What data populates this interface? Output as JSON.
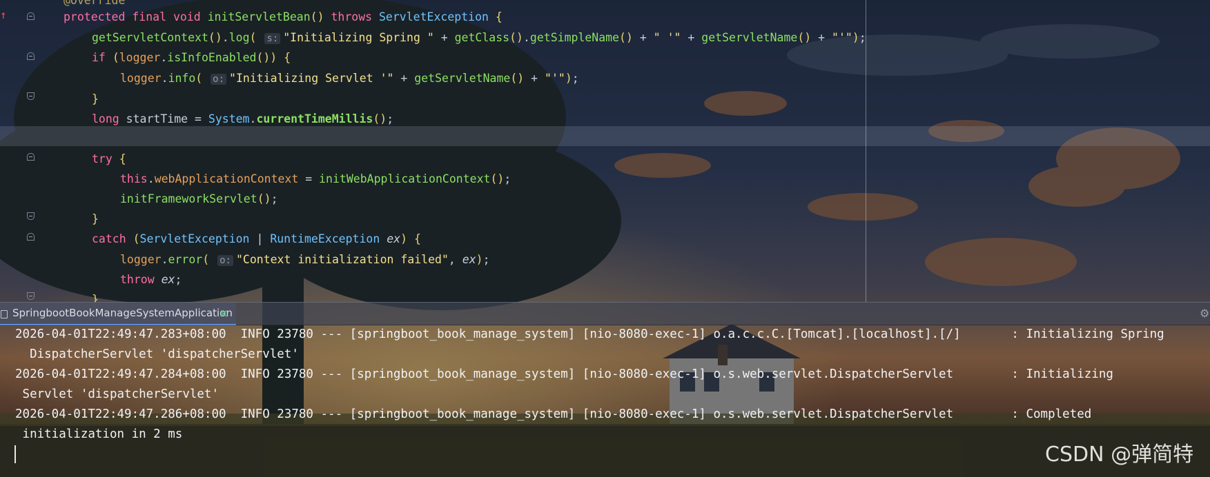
{
  "editor": {
    "lines": [
      {
        "id": "l0",
        "parts": [
          [
            "annot",
            "@Override"
          ]
        ]
      },
      {
        "id": "l1",
        "parts": [
          [
            "kw",
            "protected final void "
          ],
          [
            "fn",
            "initServletBean"
          ],
          [
            "br",
            "() "
          ],
          [
            "kw",
            "throws "
          ],
          [
            "cls",
            "ServletException "
          ],
          [
            "br",
            "{"
          ]
        ]
      },
      {
        "id": "l2",
        "parts": [
          [
            "fn",
            "getServletContext"
          ],
          [
            "br",
            "()"
          ],
          [
            "var",
            "."
          ],
          [
            "fn",
            "log"
          ],
          [
            "br",
            "( "
          ],
          [
            "hint",
            "s:"
          ],
          [
            "str",
            "\"Initializing Spring \" "
          ],
          [
            "var",
            "+ "
          ],
          [
            "fn",
            "getClass"
          ],
          [
            "br",
            "()"
          ],
          [
            "var",
            "."
          ],
          [
            "fn",
            "getSimpleName"
          ],
          [
            "br",
            "() "
          ],
          [
            "var",
            "+ "
          ],
          [
            "str",
            "\" '\" "
          ],
          [
            "var",
            "+ "
          ],
          [
            "fn",
            "getServletName"
          ],
          [
            "br",
            "() "
          ],
          [
            "var",
            "+ "
          ],
          [
            "str",
            "\"'\""
          ],
          [
            "br",
            ")"
          ],
          [
            "var",
            ";"
          ]
        ]
      },
      {
        "id": "l3",
        "parts": [
          [
            "kw",
            "if "
          ],
          [
            "br",
            "("
          ],
          [
            "fld",
            "logger"
          ],
          [
            "var",
            "."
          ],
          [
            "fn",
            "isInfoEnabled"
          ],
          [
            "br",
            "()) {"
          ]
        ]
      },
      {
        "id": "l4",
        "parts": [
          [
            "fld",
            "logger"
          ],
          [
            "var",
            "."
          ],
          [
            "fn",
            "info"
          ],
          [
            "br",
            "( "
          ],
          [
            "hint",
            "o:"
          ],
          [
            "str",
            "\"Initializing Servlet '\" "
          ],
          [
            "var",
            "+ "
          ],
          [
            "fn",
            "getServletName"
          ],
          [
            "br",
            "() "
          ],
          [
            "var",
            "+ "
          ],
          [
            "str",
            "\"'\""
          ],
          [
            "br",
            ")"
          ],
          [
            "var",
            ";"
          ]
        ]
      },
      {
        "id": "l5",
        "parts": [
          [
            "br",
            "}"
          ]
        ]
      },
      {
        "id": "l6",
        "parts": [
          [
            "kw",
            "long "
          ],
          [
            "var",
            "startTime = "
          ],
          [
            "cls",
            "System"
          ],
          [
            "var",
            "."
          ],
          [
            "fnb",
            "currentTimeMillis"
          ],
          [
            "br",
            "()"
          ],
          [
            "var",
            ";"
          ]
        ]
      },
      {
        "id": "l7",
        "parts": []
      },
      {
        "id": "l8",
        "parts": [
          [
            "kw",
            "try "
          ],
          [
            "br",
            "{"
          ]
        ]
      },
      {
        "id": "l9",
        "parts": [
          [
            "kw",
            "this"
          ],
          [
            "var",
            "."
          ],
          [
            "fld",
            "webApplicationContext "
          ],
          [
            "var",
            "= "
          ],
          [
            "fn",
            "initWebApplicationContext"
          ],
          [
            "br",
            "()"
          ],
          [
            "var",
            ";"
          ]
        ]
      },
      {
        "id": "l10",
        "parts": [
          [
            "fn",
            "initFrameworkServlet"
          ],
          [
            "br",
            "()"
          ],
          [
            "var",
            ";"
          ]
        ]
      },
      {
        "id": "l11",
        "parts": [
          [
            "br",
            "}"
          ]
        ]
      },
      {
        "id": "l12",
        "parts": [
          [
            "kw",
            "catch "
          ],
          [
            "br",
            "("
          ],
          [
            "cls",
            "ServletException "
          ],
          [
            "var",
            "| "
          ],
          [
            "cls",
            "RuntimeException "
          ],
          [
            "var it",
            "ex"
          ],
          [
            "br",
            ") {"
          ]
        ]
      },
      {
        "id": "l13",
        "parts": [
          [
            "fld",
            "logger"
          ],
          [
            "var",
            "."
          ],
          [
            "fn",
            "error"
          ],
          [
            "br",
            "( "
          ],
          [
            "hint",
            "o:"
          ],
          [
            "str",
            "\"Context initialization failed\""
          ],
          [
            "var",
            ", "
          ],
          [
            "var it",
            "ex"
          ],
          [
            "br",
            ")"
          ],
          [
            "var",
            ";"
          ]
        ]
      },
      {
        "id": "l14",
        "parts": [
          [
            "kw",
            "throw "
          ],
          [
            "var it",
            "ex"
          ],
          [
            "var",
            ";"
          ]
        ]
      },
      {
        "id": "l15",
        "parts": [
          [
            "br",
            "}"
          ]
        ]
      }
    ]
  },
  "run_panel": {
    "tab_label": "SpringbootBookManageSystemApplication",
    "close_glyph": "×",
    "settings_glyph": "⚙"
  },
  "console": {
    "lines": [
      "2026-04-01T22:49:47.283+08:00  INFO 23780 --- [springboot_book_manage_system] [nio-8080-exec-1] o.a.c.c.C.[Tomcat].[localhost].[/]       : Initializing Spring",
      "  DispatcherServlet 'dispatcherServlet'",
      "2026-04-01T22:49:47.284+08:00  INFO 23780 --- [springboot_book_manage_system] [nio-8080-exec-1] o.s.web.servlet.DispatcherServlet        : Initializing",
      " Servlet 'dispatcherServlet'",
      "2026-04-01T22:49:47.286+08:00  INFO 23780 --- [springboot_book_manage_system] [nio-8080-exec-1] o.s.web.servlet.DispatcherServlet        : Completed",
      " initialization in 2 ms"
    ]
  },
  "watermark": "CSDN @弹简特",
  "colors": {
    "keyword": "#ff6fa3",
    "method": "#8be062",
    "class": "#6fc3ff",
    "string": "#f2e08c",
    "field": "#e6a15a"
  }
}
